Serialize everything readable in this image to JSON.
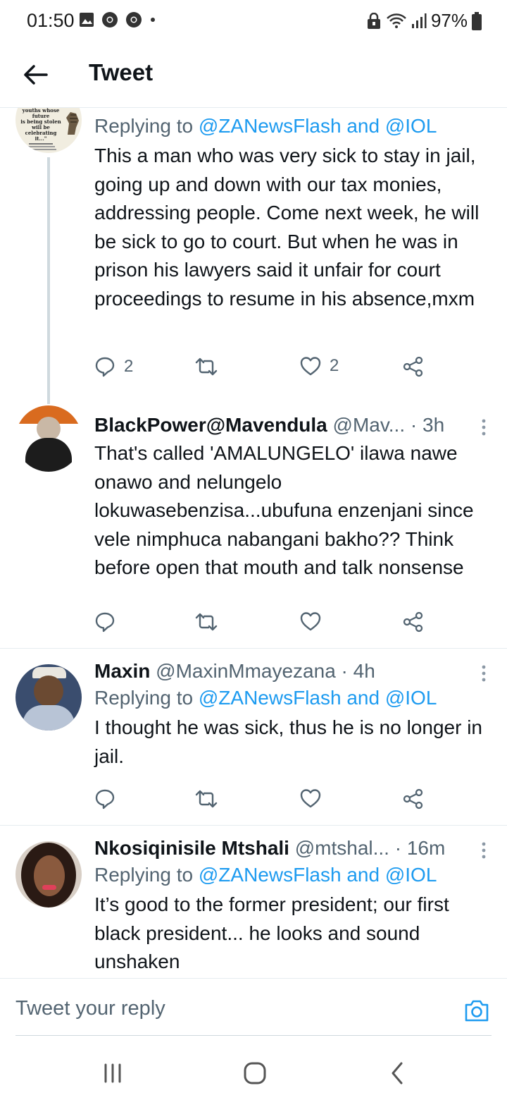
{
  "status_bar": {
    "time": "01:50",
    "battery": "97%"
  },
  "header": {
    "title": "Tweet"
  },
  "tweets": [
    {
      "replying_prefix": "Replying to ",
      "replying_to": "@ZANewsFlash and @IOL",
      "avatar_lines": [
        "youths whose future",
        "is being stolen will be",
        "celebrating it...\""
      ],
      "text": "This a man who was very sick to stay in jail, going up and down with our tax monies, addressing people. Come next week, he will be sick to go to court. But when he was in prison his lawyers said it unfair for court proceedings to resume in his absence,mxm",
      "replies": "2",
      "likes": "2"
    },
    {
      "name": "BlackPower@Mavendula",
      "handle": "@Mav...",
      "time": "· 3h",
      "text": "That's called 'AMALUNGELO' ilawa nawe onawo and nelungelo lokuwasebenzisa...ubufuna enzenjani since vele nimphuca nabangani bakho?? Think before open that mouth and talk nonsense"
    },
    {
      "name": "Maxin",
      "handle": "@MaxinMmayezana",
      "time": "· 4h",
      "replying_prefix": "Replying to ",
      "replying_to": "@ZANewsFlash and @IOL",
      "text": "I thought he was sick, thus he is no longer in jail."
    },
    {
      "name": "Nkosiqinisile Mtshali",
      "handle": "@mtshal...",
      "time": "· 16m",
      "replying_prefix": "Replying to ",
      "replying_to": "@ZANewsFlash and @IOL",
      "text": "It’s good to the former president; our first black president...  he looks and sound unshaken"
    }
  ],
  "composer": {
    "placeholder": "Tweet your reply"
  },
  "colors": {
    "accent": "#1d9bf0",
    "muted": "#536471",
    "text": "#0f1419",
    "divider": "#e6ecf0"
  },
  "icons": [
    "back-arrow-icon",
    "reply-icon",
    "retweet-icon",
    "like-icon",
    "share-icon",
    "more-icon",
    "camera-icon",
    "recents-icon",
    "home-icon",
    "nav-back-icon",
    "wifi-icon",
    "signal-icon",
    "battery-icon",
    "gallery-icon",
    "chrome-icon",
    "lock-icon"
  ]
}
